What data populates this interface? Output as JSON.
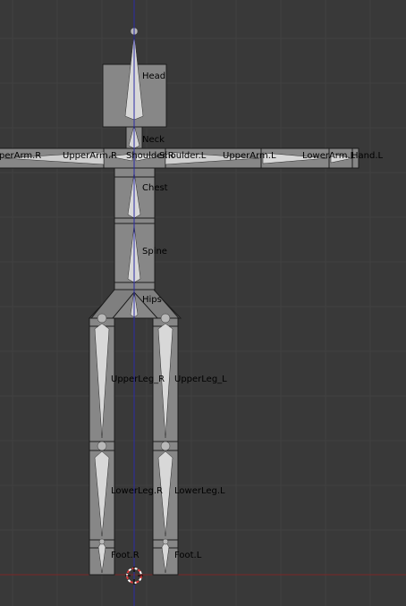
{
  "viewport": {
    "background": "#393939",
    "grid_color": "#414141",
    "axis_x_color": "#7a2626",
    "axis_z_color": "#2a2aa6",
    "mesh_fill": "#878787",
    "mesh_edge": "#1c1c1c",
    "bone_fill": "#d8d8d8",
    "bone_shade": "#a8a8a8",
    "cursor_colors": [
      "#e23b3b",
      "#ffffff"
    ]
  },
  "bones": {
    "head": "Head",
    "neck": "Neck",
    "upperarm_r": "UpperArm.R",
    "upperarm_r_cut": "perArm.R",
    "shoulder_r": "Shoulder.R",
    "shoulder_l": "Shoulder.L",
    "upperarm_l": "UpperArm.L",
    "lowerarm_l": "LowerArm.L",
    "hand_l": "Hand.L",
    "chest": "Chest",
    "spine": "Spine",
    "hips": "Hips",
    "upperleg_r": "UpperLeg_R",
    "upperleg_l": "UpperLeg_L",
    "lowerleg_r": "LowerLeg.R",
    "lowerleg_l": "LowerLeg.L",
    "foot_r": "Foot.R",
    "foot_l": "Foot.L"
  }
}
